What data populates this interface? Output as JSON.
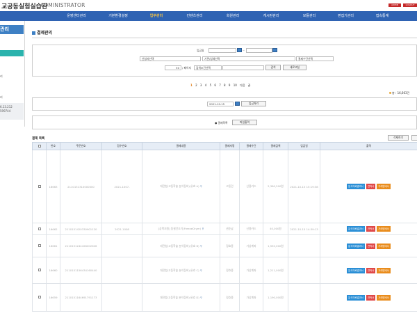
{
  "header": {
    "site_name": "교공동실험실습관",
    "admin_label": "ADMINISTRATOR",
    "btn_a": "ADMIN",
    "btn_b": "LOGOUT"
  },
  "nav": {
    "items": [
      {
        "label": "운영센터관리"
      },
      {
        "label": "기본환경설정"
      },
      {
        "label": "업무관리"
      },
      {
        "label": "컨텐츠관리"
      },
      {
        "label": "회원관리"
      },
      {
        "label": "게시판관리"
      },
      {
        "label": "모듈관리"
      },
      {
        "label": "편집기관리"
      },
      {
        "label": "접속통계"
      }
    ],
    "active_index": 2,
    "active_color": "#f5c242",
    "bg_color": "#2f63b3"
  },
  "sidebar": {
    "heading": "관리",
    "labels": [
      "리",
      "리"
    ],
    "info_line1": "6.13.212",
    "info_line2": "599744"
  },
  "main": {
    "title": "결제관리",
    "search": {
      "date_label": "입금일",
      "date_sep": "~",
      "select_applicant": "신청자선택",
      "select_org": "기관/업체선택",
      "select_method": "결제수단선택",
      "page_size": "50",
      "page_size_label": "/ 페이지",
      "select_condition": "검색조건선택",
      "search_button": "검색",
      "reset_button": "새로고침"
    },
    "pager": {
      "pages": [
        "1",
        "2",
        "3",
        "4",
        "5",
        "6",
        "7",
        "8",
        "9",
        "10"
      ],
      "current": "1",
      "next": "다음",
      "last": "끝"
    },
    "count_text": "총 : 16,663건",
    "deposit": {
      "date_value": "2021-10-15",
      "button": "입금처리"
    },
    "excel": {
      "label": "결제목록",
      "button": "파일출력"
    },
    "list": {
      "title": "결제 목록",
      "delete_button": "삭제하기",
      "columns": [
        "",
        "번호",
        "주문번호",
        "접수번호",
        "결제내용",
        "결제자명",
        "결제수단",
        "결제금액",
        "입금일",
        "출력"
      ],
      "rows": [
        {
          "no": "16663",
          "order": "2110151310000000",
          "receipt": "2021-1007-",
          "content": "대전청(고등학술 분석장비)(유효 A)",
          "payer": "고동민",
          "method": "신용카드",
          "amount": "2,360,500원",
          "paid": "2021-10-15 15:19:38",
          "print": [
            "분석의뢰결과서",
            "견적서",
            "거래명세서"
          ]
        },
        {
          "no": "16662",
          "order": "2110151420330901120",
          "receipt": "2021-1008",
          "content": "[공학지원] 동결건조기(FreezeDryer)",
          "payer": "권순남",
          "method": "신용카드",
          "amount": "40,000원",
          "paid": "2021-10-15 14:39:13",
          "print": [
            "분석의뢰결과서",
            "견적서",
            "거래명세서"
          ]
        },
        {
          "no": "16661",
          "order": "2110151244428002626",
          "receipt": "",
          "content": "대전청(고등학술 분석장비)(유효 B)",
          "payer": "정효종",
          "method": "가상계좌",
          "amount": "1,550,000원",
          "paid": "",
          "print": [
            "분석의뢰결과서",
            "견적서",
            "거래명세서"
          ]
        },
        {
          "no": "16660",
          "order": "2110151156434160440",
          "receipt": "",
          "content": "대전청(고등학술 분석장비)(유효 C)",
          "payer": "정효종",
          "method": "가상계좌",
          "amount": "1,211,000원",
          "paid": "",
          "print": [
            "분석의뢰결과서",
            "견적서",
            "거래명세서"
          ]
        },
        {
          "no": "16659",
          "order": "2110151164691791173",
          "receipt": "",
          "content": "대전청(고등학술 분석장비)(유효 D)",
          "payer": "정효종",
          "method": "가상계좌",
          "amount": "1,190,000원",
          "paid": "",
          "print": [
            "분석의뢰결과서",
            "견적서",
            "거래명세서"
          ]
        }
      ]
    }
  },
  "colors": {
    "accent": "#3e80c4",
    "teal": "#2bb3ad",
    "btn_blue": "#2b8fd6",
    "btn_red": "#e04848",
    "btn_orange": "#e98c1c"
  }
}
